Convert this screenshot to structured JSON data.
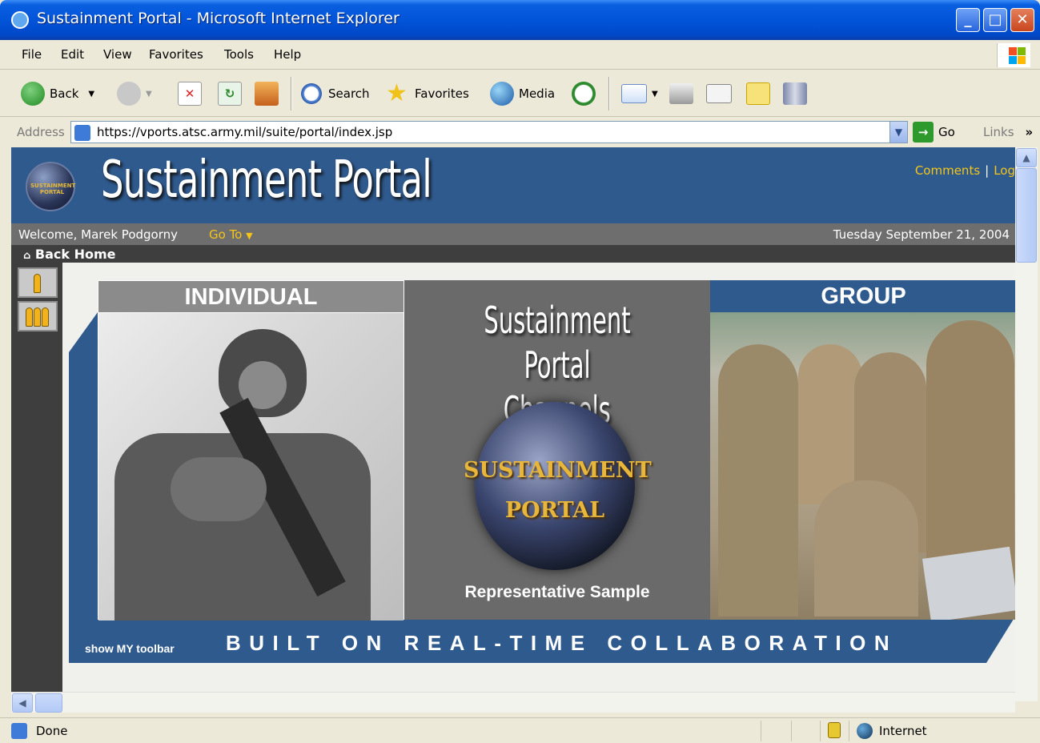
{
  "window": {
    "title": "Sustainment Portal - Microsoft Internet Explorer"
  },
  "menu": [
    "File",
    "Edit",
    "View",
    "Favorites",
    "Tools",
    "Help"
  ],
  "toolbar": {
    "back": "Back",
    "search": "Search",
    "favorites": "Favorites",
    "media": "Media"
  },
  "address": {
    "label": "Address",
    "url": "https://vports.atsc.army.mil/suite/portal/index.jsp",
    "go": "Go",
    "links": "Links"
  },
  "portal": {
    "title": "Sustainment Portal",
    "logo_text": "SUSTAINMENT PORTAL",
    "comments": "Comments",
    "logout": "Log",
    "welcome": "Welcome, Marek Podgorny",
    "goto": "Go To",
    "date": "Tuesday September 21, 2004",
    "back_home": "Back Home"
  },
  "banner": {
    "individual": "INDIVIDUAL",
    "group": "GROUP",
    "center_title_line1": "Sustainment Portal",
    "center_title_line2": "Channels",
    "emblem_line1": "SUSTAINMENT",
    "emblem_line2": "PORTAL",
    "sample": "Representative Sample",
    "show_toolbar": "show MY toolbar",
    "tagline": "BUILT ON REAL-TIME COLLABORATION"
  },
  "status": {
    "text": "Done",
    "zone": "Internet"
  },
  "colors": {
    "portal_blue": "#2F5A8E",
    "accent_yellow": "#F5C518",
    "xp_blue": "#0254D8"
  }
}
